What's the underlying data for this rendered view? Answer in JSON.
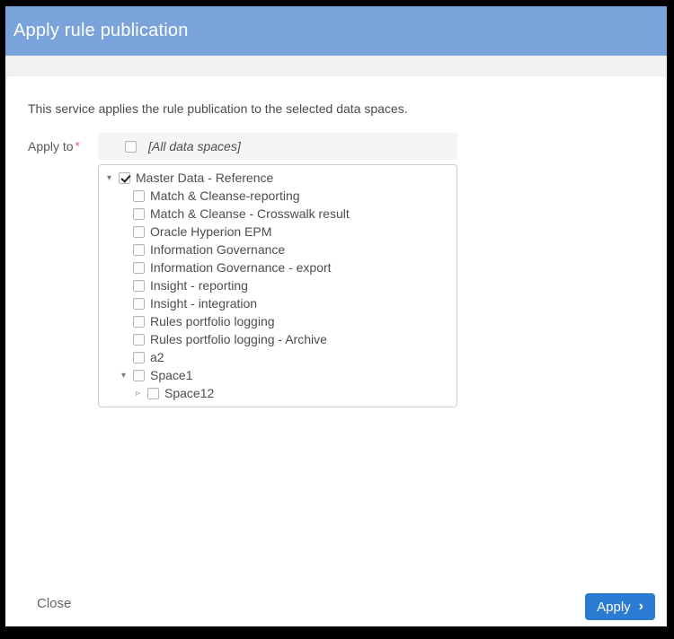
{
  "header": {
    "title": "Apply rule publication"
  },
  "description": "This service applies the rule publication to the selected data spaces.",
  "form": {
    "label": "Apply to",
    "required_marker": "*",
    "all_spaces": {
      "label": "[All data spaces]",
      "checked": false
    },
    "tree": [
      {
        "label": "Master Data - Reference",
        "level": 0,
        "checked": true,
        "caret": "expanded"
      },
      {
        "label": "Match & Cleanse-reporting",
        "level": 1,
        "checked": false,
        "caret": "none"
      },
      {
        "label": "Match & Cleanse - Crosswalk result",
        "level": 1,
        "checked": false,
        "caret": "none"
      },
      {
        "label": "Oracle Hyperion EPM",
        "level": 1,
        "checked": false,
        "caret": "none"
      },
      {
        "label": "Information Governance",
        "level": 1,
        "checked": false,
        "caret": "none"
      },
      {
        "label": "Information Governance - export",
        "level": 1,
        "checked": false,
        "caret": "none"
      },
      {
        "label": "Insight - reporting",
        "level": 1,
        "checked": false,
        "caret": "none"
      },
      {
        "label": "Insight - integration",
        "level": 1,
        "checked": false,
        "caret": "none"
      },
      {
        "label": "Rules portfolio logging",
        "level": 1,
        "checked": false,
        "caret": "none"
      },
      {
        "label": "Rules portfolio logging - Archive",
        "level": 1,
        "checked": false,
        "caret": "none"
      },
      {
        "label": "a2",
        "level": 1,
        "checked": false,
        "caret": "none"
      },
      {
        "label": "Space1",
        "level": 1,
        "checked": false,
        "caret": "expanded"
      },
      {
        "label": "Space12",
        "level": 2,
        "checked": false,
        "caret": "collapsed"
      }
    ]
  },
  "footer": {
    "close_label": "Close",
    "apply_label": "Apply",
    "apply_chevron": "›"
  },
  "icons": {
    "caret_expanded": "▾",
    "caret_collapsed": "▹"
  },
  "colors": {
    "header_background": "#7aa2db",
    "apply_button": "#2b7bd3",
    "required_marker": "#e8534e"
  }
}
